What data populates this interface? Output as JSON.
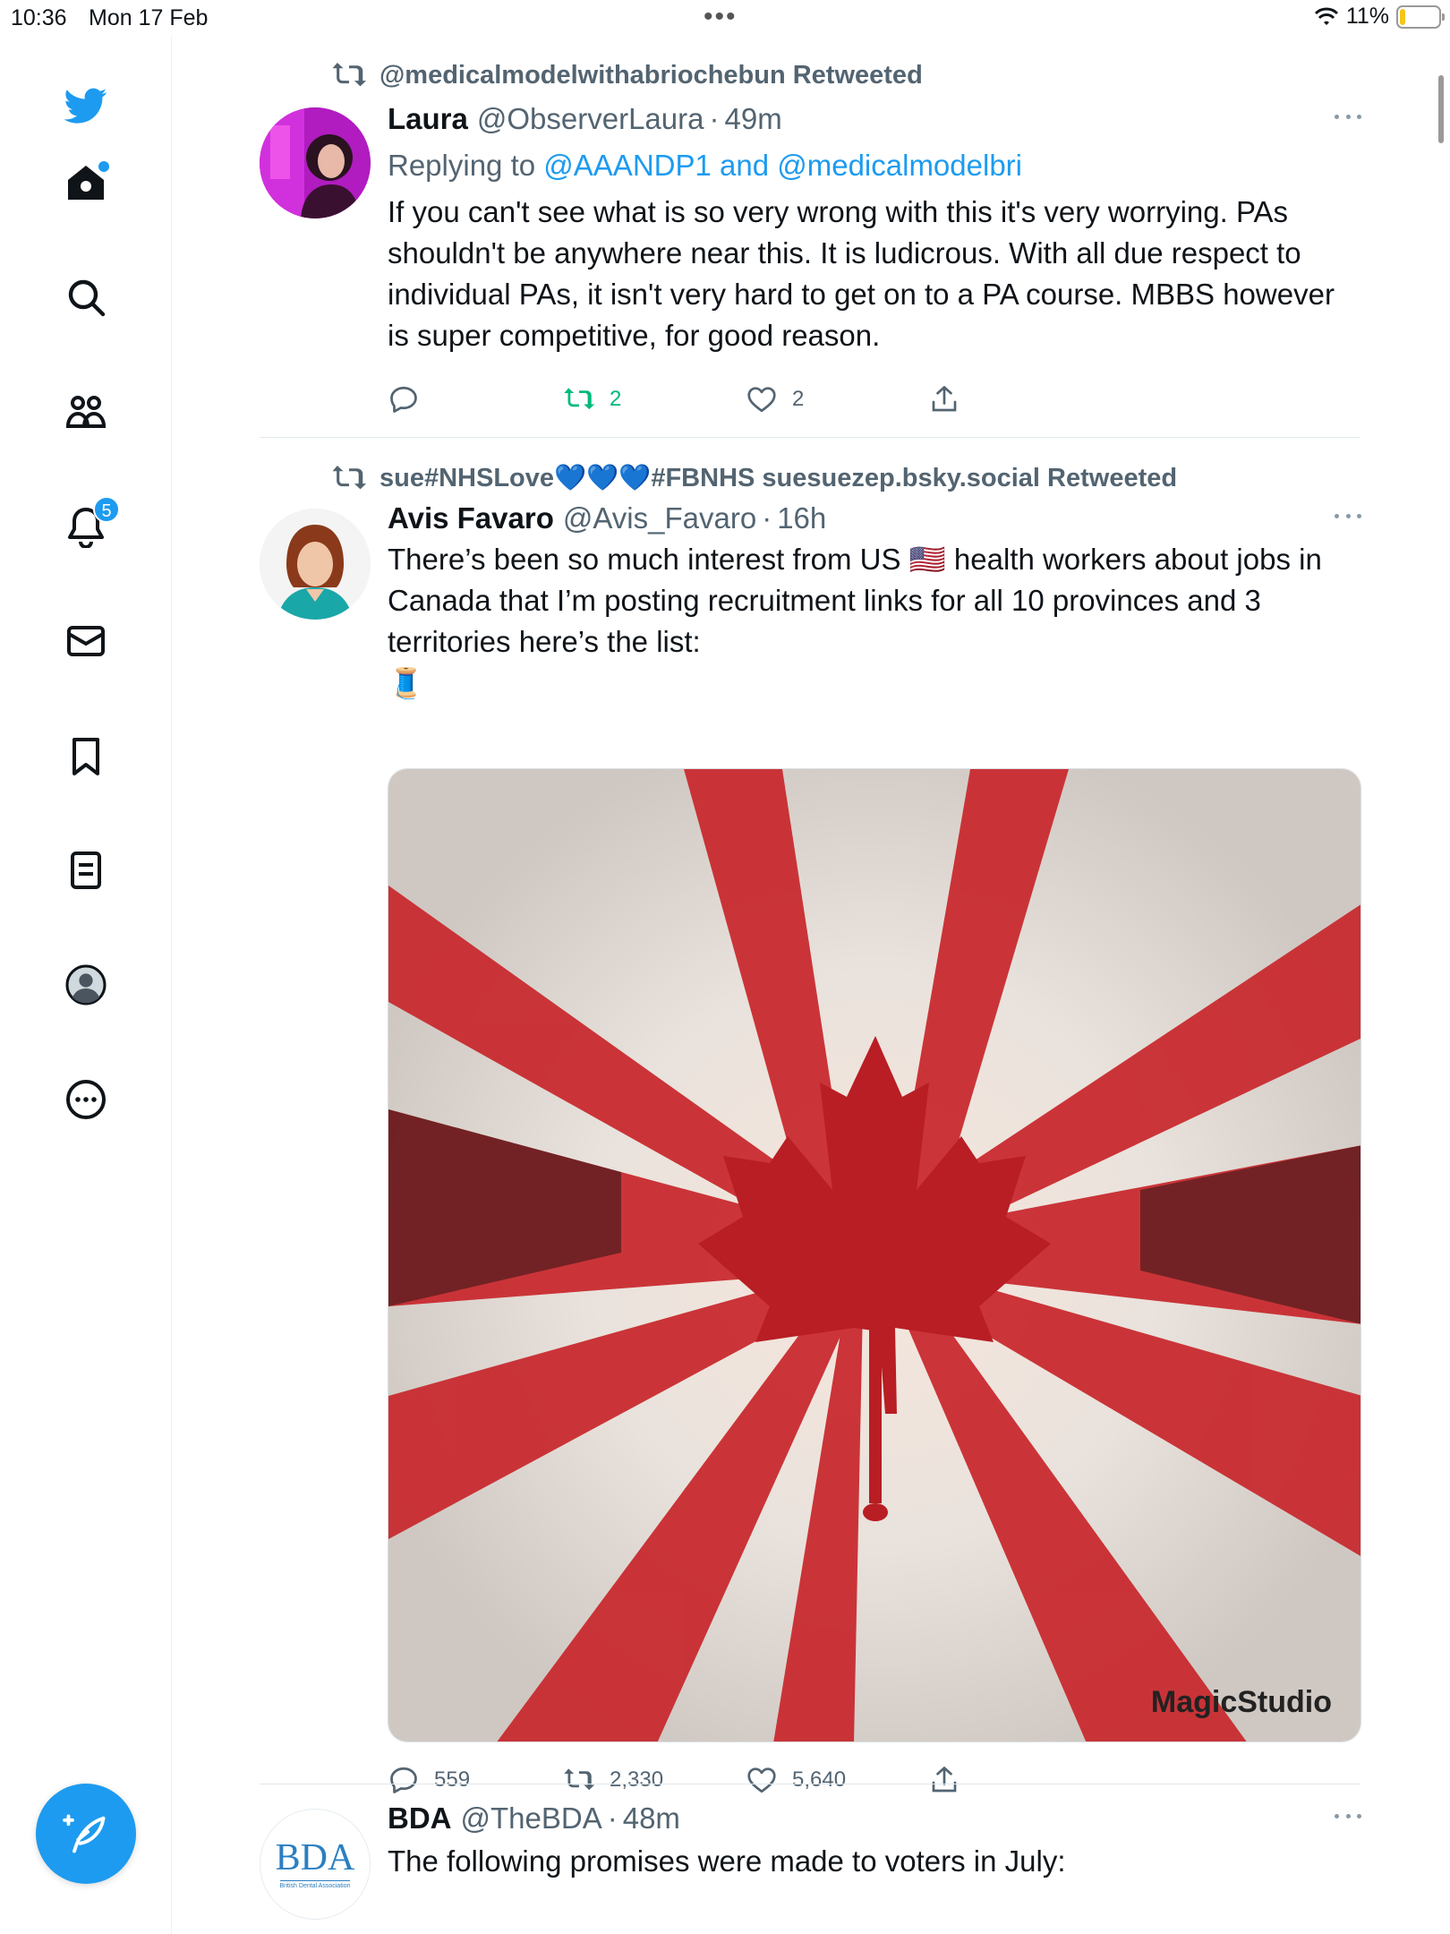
{
  "status_bar": {
    "time": "10:36",
    "date": "Mon 17 Feb",
    "battery": "11%"
  },
  "sidebar": {
    "items": [
      {
        "icon": "twitter-bird-icon"
      },
      {
        "icon": "home-icon"
      },
      {
        "icon": "search-icon"
      },
      {
        "icon": "communities-icon"
      },
      {
        "icon": "notifications-icon",
        "badge": "5"
      },
      {
        "icon": "messages-icon"
      },
      {
        "icon": "bookmarks-icon"
      },
      {
        "icon": "lists-icon"
      },
      {
        "icon": "profile-icon"
      },
      {
        "icon": "more-icon"
      }
    ],
    "compose_icon": "compose-tweet-icon"
  },
  "colors": {
    "accent": "#1d9bf0",
    "retweet_green": "#00ba7c",
    "secondary_text": "#536471"
  },
  "tweets": [
    {
      "retweeted_by": "@medicalmodelwithabriochebun Retweeted",
      "name": "Laura",
      "handle": "@ObserverLaura",
      "sep": "·",
      "time": "49m",
      "reply_prefix": "Replying to",
      "reply_targets": "@AAANDP1 and @medicalmodelbri",
      "text": "If you can't see what is so very wrong with this it's very worrying.  PAs shouldn't be anywhere near this.  It is ludicrous.  With all due respect to individual PAs, it isn't very hard to get on to a PA course.  MBBS however is super competitive, for good reason.",
      "replies": "",
      "retweets": "2",
      "likes": "2"
    },
    {
      "retweeted_by": "sue#NHSLove💙💙💙#FBNHS suesuezep.bsky.social Retweeted",
      "name": "Avis Favaro",
      "handle": "@Avis_Favaro",
      "sep": "·",
      "time": "16h",
      "text_line1": "There’s been so much interest from US 🇺🇸 health workers about jobs in Canada that I’m posting recruitment links for all 10 provinces and 3 territories here’s the list:",
      "text_line2": "🧵",
      "media_credit": "MagicStudio",
      "replies": "559",
      "retweets": "2,330",
      "likes": "5,640"
    },
    {
      "name": "BDA",
      "handle": "@TheBDA",
      "sep": "·",
      "time": "48m",
      "avatar_text": "BDA",
      "avatar_subtext": "British Dental Association",
      "text": "The following promises were made to voters in July:"
    }
  ]
}
